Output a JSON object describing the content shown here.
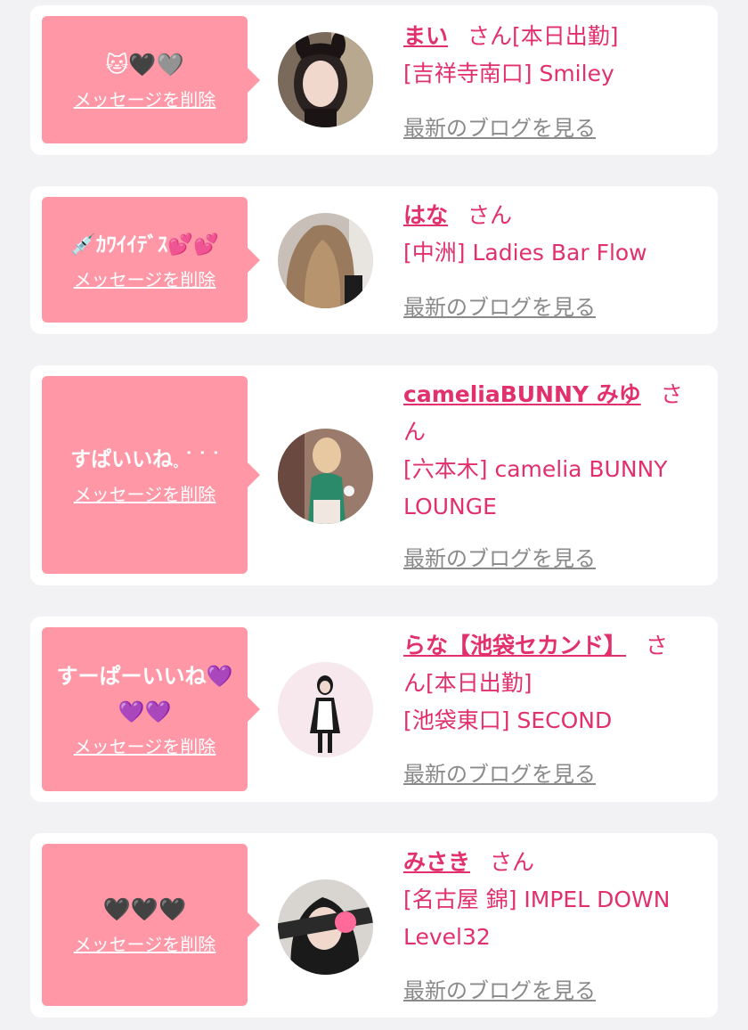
{
  "delete_label": "メッセージを削除",
  "blog_label": "最新のブログを見る",
  "colors": {
    "accent": "#e1306c",
    "bubble": "#ff97a6",
    "link_gray": "#8a8a8a"
  },
  "cards": [
    {
      "message": "🐱🖤🩶",
      "name": "まい",
      "san": "さん",
      "line1_suffix": "[本日出勤]",
      "line2": "[吉祥寺南口] Smiley"
    },
    {
      "message": "💉ｶﾜｲｲﾃﾞｽ💕💕",
      "name": "はな",
      "san": "さん",
      "line1_suffix": "",
      "line2": "[中洲] Ladies Bar Flow"
    },
    {
      "message": "すぱいいね𓈒 ᐝ ᐝ ᐝ",
      "name": "cameliaBUNNY みゆ",
      "san": "さ",
      "line1_suffix": "ん",
      "line2": "[六本木] camelia BUNNY LOUNGE"
    },
    {
      "message": "すーぱーいいね💜💜💜",
      "name": "らな【池袋セカンド】",
      "san": "さ",
      "line1_suffix": "ん[本日出勤]",
      "line2": "[池袋東口] SECOND"
    },
    {
      "message": "🖤🖤🖤",
      "name": "みさき",
      "san": "さん",
      "line1_suffix": "",
      "line2": "[名古屋 錦] IMPEL DOWN Level32"
    }
  ]
}
